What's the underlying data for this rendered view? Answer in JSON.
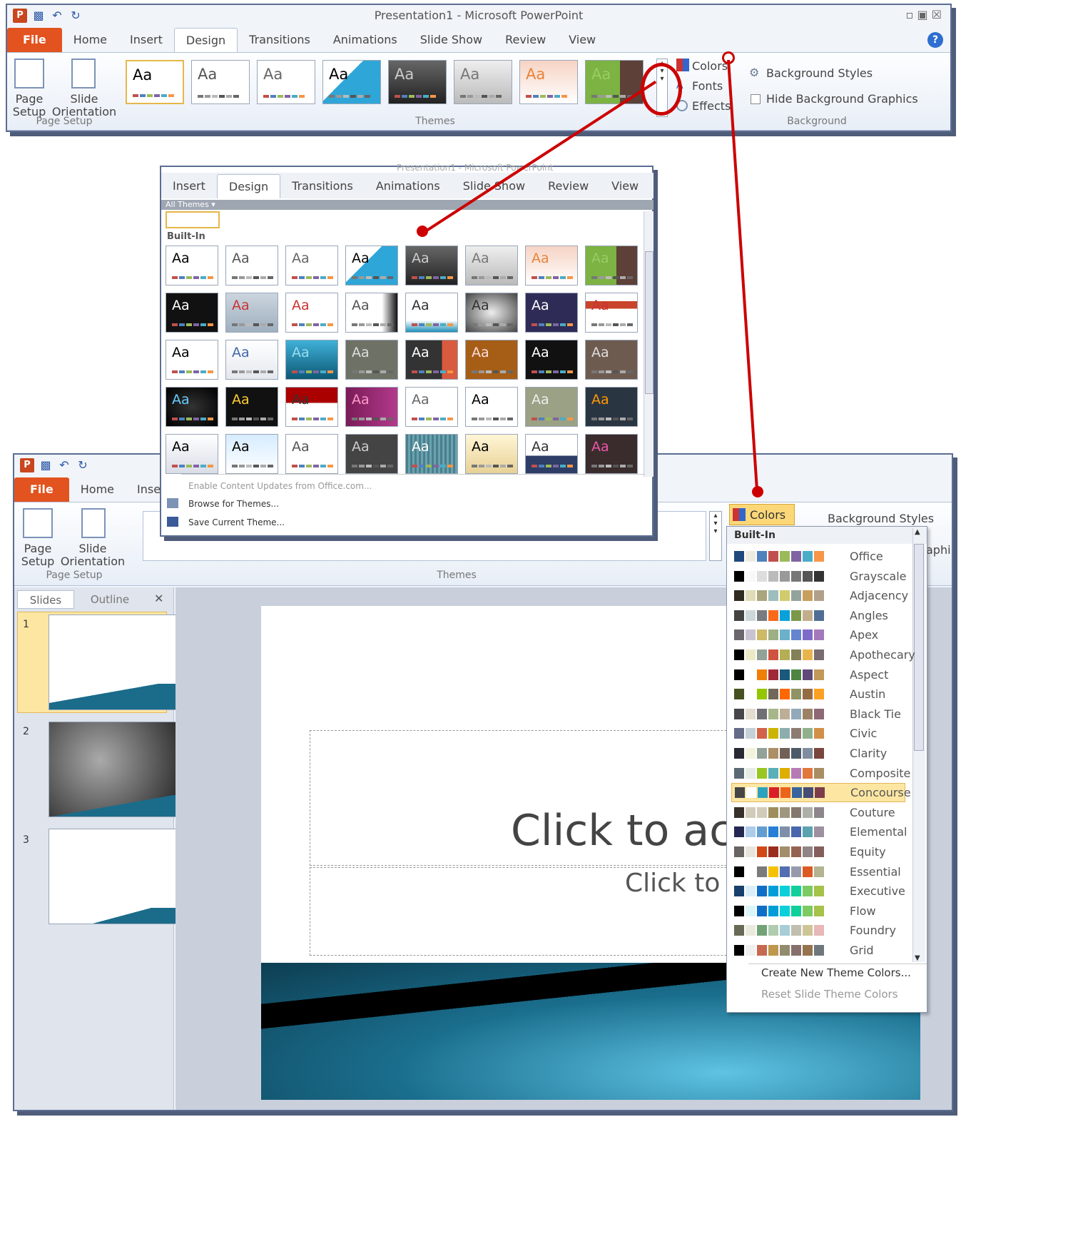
{
  "top_window": {
    "title": "Presentation1  -  Microsoft PowerPoint",
    "tabs": [
      "File",
      "Home",
      "Insert",
      "Design",
      "Transitions",
      "Animations",
      "Slide Show",
      "Review",
      "View"
    ],
    "page_setup": {
      "page_setup": "Page Setup",
      "orientation": "Slide Orientation",
      "label": "Page Setup"
    },
    "themes_label": "Themes",
    "theme_aa": "Aa",
    "colors": "Colors",
    "fonts": "Fonts",
    "effects": "Effects",
    "bg_styles": "Background Styles",
    "hide_bg": "Hide Background Graphics",
    "bg_label": "Background"
  },
  "gallery": {
    "title_bg": "Presentation1 - Microsoft PowerPoint",
    "tabs": [
      "Insert",
      "Design",
      "Transitions",
      "Animations",
      "Slide Show",
      "Review",
      "View"
    ],
    "all_themes": "All Themes",
    "built_in": "Built-In",
    "theme_aa": "Aa",
    "menu_items": [
      "Enable Content Updates from Office.com...",
      "Browse for Themes...",
      "Save Current Theme..."
    ]
  },
  "bottom_window": {
    "tabs": [
      "File",
      "Home",
      "Inse"
    ],
    "page_setup": {
      "page_setup": "Page Setup",
      "orientation": "Slide Orientation",
      "label": "Page Setup"
    },
    "themes_label": "Themes",
    "colors_btn": "Colors",
    "bg_styles": "Background Styles",
    "aphi": "aphi",
    "panel_tabs": [
      "Slides",
      "Outline"
    ],
    "slide_numbers": [
      "1",
      "2",
      "3"
    ],
    "title_placeholder": "Click to ac",
    "subtitle_placeholder": "Click to a"
  },
  "colors_menu": {
    "header": "Built-In",
    "items": [
      "Office",
      "Grayscale",
      "Adjacency",
      "Angles",
      "Apex",
      "Apothecary",
      "Aspect",
      "Austin",
      "Black Tie",
      "Civic",
      "Clarity",
      "Composite",
      "Concourse",
      "Couture",
      "Elemental",
      "Equity",
      "Essential",
      "Executive",
      "Flow",
      "Foundry",
      "Grid"
    ],
    "selected": "Concourse",
    "create": "Create New Theme Colors...",
    "reset": "Reset Slide Theme Colors"
  }
}
